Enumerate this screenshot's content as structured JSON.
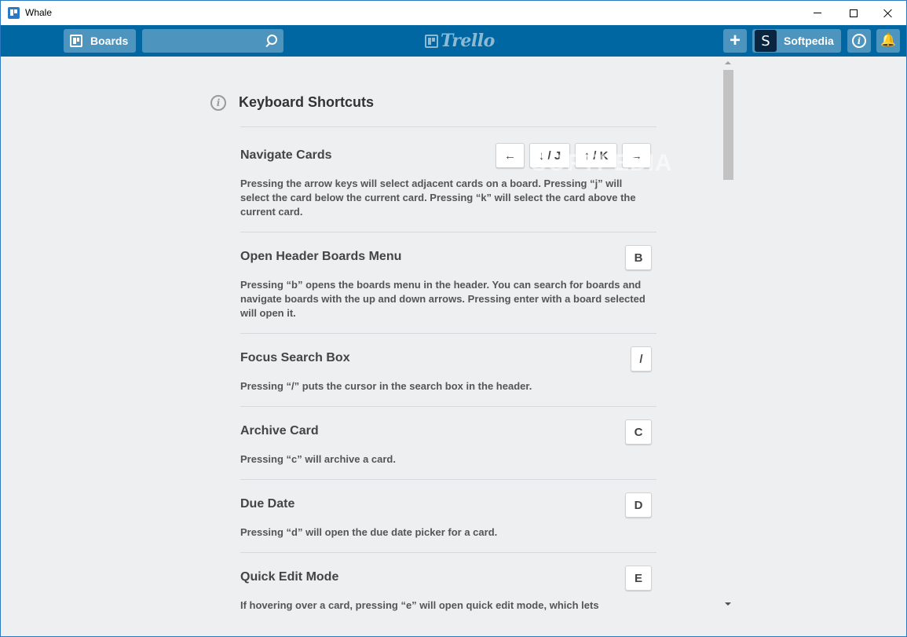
{
  "window": {
    "title": "Whale"
  },
  "header": {
    "boards_label": "Boards",
    "search_value": "",
    "logo_text": "Trello",
    "add_label": "+",
    "user": {
      "initial": "S",
      "name": "Softpedia"
    },
    "info_glyph": "i",
    "bell_glyph": "🔔"
  },
  "page": {
    "info_glyph": "i",
    "title": "Keyboard Shortcuts",
    "watermark": "SOFTPEDIA",
    "shortcuts": [
      {
        "name": "Navigate Cards",
        "keys": [
          "←",
          "↓ / J",
          "↑ / K",
          "→"
        ],
        "description": "Pressing the arrow keys will select adjacent cards on a board. Pressing “j” will select the card below the current card. Pressing “k” will select the card above the current card."
      },
      {
        "name": "Open Header Boards Menu",
        "keys": [
          "B"
        ],
        "description": "Pressing “b” opens the boards menu in the header. You can search for boards and navigate boards with the up and down arrows. Pressing enter with a board selected will open it."
      },
      {
        "name": "Focus Search Box",
        "keys": [
          "/"
        ],
        "description": "Pressing “/” puts the cursor in the search box in the header."
      },
      {
        "name": "Archive Card",
        "keys": [
          "C"
        ],
        "description": "Pressing “c” will archive a card."
      },
      {
        "name": "Due Date",
        "keys": [
          "D"
        ],
        "description": "Pressing “d” will open the due date picker for a card."
      },
      {
        "name": "Quick Edit Mode",
        "keys": [
          "E"
        ],
        "description": "If hovering over a card, pressing “e” will open quick edit mode, which lets"
      }
    ]
  },
  "colors": {
    "header_bg": "#0067a3",
    "content_bg": "#edeff0",
    "avatar_bg": "#0a2540"
  }
}
